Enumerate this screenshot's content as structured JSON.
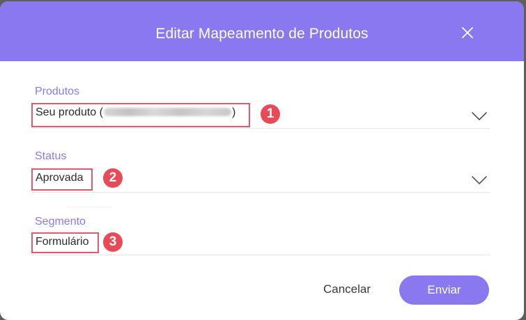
{
  "dialog": {
    "title": "Editar Mapeamento de Produtos",
    "close_icon": "close-icon"
  },
  "fields": {
    "produtos": {
      "label": "Produtos",
      "value_prefix": "Seu produto (",
      "value_suffix": ")",
      "badge": "1"
    },
    "status": {
      "label": "Status",
      "value": "Aprovada",
      "badge": "2"
    },
    "segmento": {
      "label": "Segmento",
      "value": "Formulário",
      "badge": "3"
    }
  },
  "actions": {
    "cancel_label": "Cancelar",
    "send_label": "Enviar"
  },
  "colors": {
    "accent": "#8a78f0",
    "highlight_border": "#e25a6a",
    "badge": "#e84b57"
  }
}
